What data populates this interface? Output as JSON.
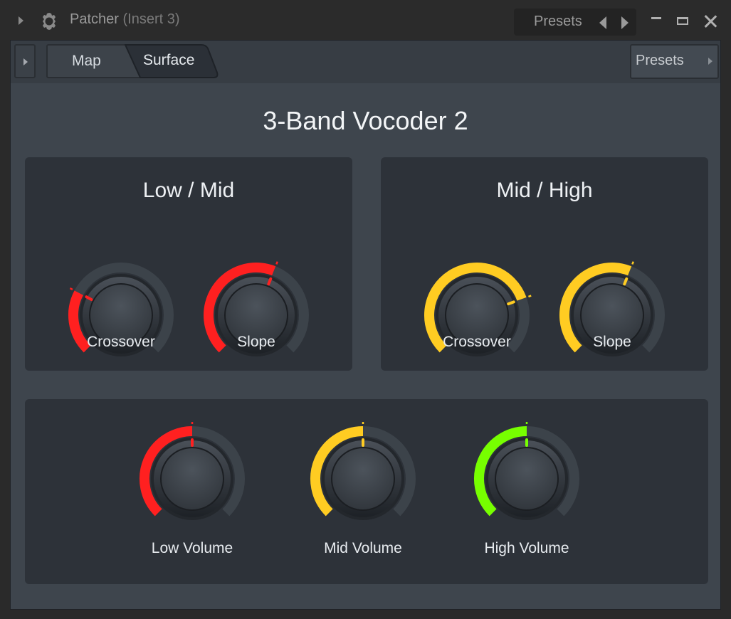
{
  "window": {
    "title": "Patcher",
    "subtitle": "(Insert 3)",
    "presets_label": "Presets",
    "icons": {
      "menu": "triangle-right-icon",
      "app": "gear-icon",
      "prev": "arrow-left-icon",
      "next": "arrow-right-icon",
      "minimize": "minimize-icon",
      "maximize": "maximize-icon",
      "close": "close-icon"
    }
  },
  "toolbar": {
    "tabs": [
      {
        "label": "Map",
        "active": false
      },
      {
        "label": "Surface",
        "active": true
      }
    ],
    "presets_label": "Presets"
  },
  "surface": {
    "title": "3-Band Vocoder 2",
    "panels": [
      {
        "title": "Low / Mid",
        "knobs": [
          {
            "label": "Crossover",
            "value": 0.27,
            "color": "#ff2020"
          },
          {
            "label": "Slope",
            "value": 0.58,
            "color": "#ff2020"
          }
        ]
      },
      {
        "title": "Mid / High",
        "knobs": [
          {
            "label": "Crossover",
            "value": 0.76,
            "color": "#ffcc22"
          },
          {
            "label": "Slope",
            "value": 0.58,
            "color": "#ffcc22"
          }
        ]
      },
      {
        "title": "",
        "knobs": [
          {
            "label": "Low Volume",
            "value": 0.5,
            "color": "#ff2020"
          },
          {
            "label": "Mid Volume",
            "value": 0.5,
            "color": "#ffcc22"
          },
          {
            "label": "High Volume",
            "value": 0.5,
            "color": "#77ff00"
          }
        ]
      }
    ]
  }
}
